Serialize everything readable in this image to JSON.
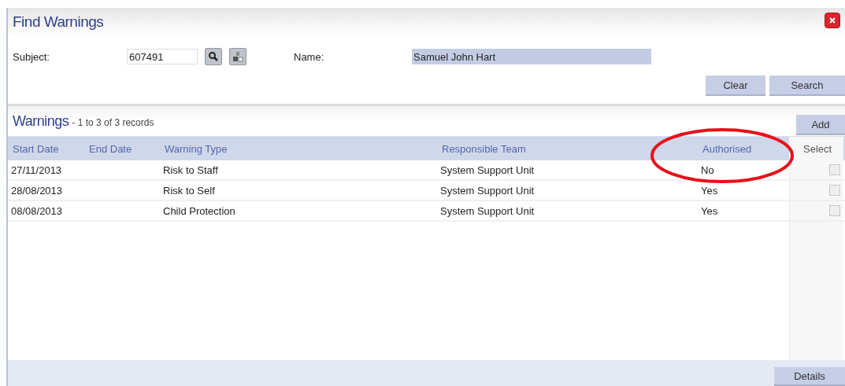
{
  "window": {
    "title": "Find Warnings"
  },
  "search": {
    "subject_label": "Subject:",
    "subject_value": "607491",
    "name_label": "Name:",
    "name_value": "Samuel John Hart",
    "buttons": [
      "Clear",
      "Search"
    ]
  },
  "section": {
    "title": "Warnings",
    "summary": "- 1 to 3 of 3 records",
    "add_button": "Add"
  },
  "table": {
    "columns": [
      "Start Date",
      "End Date",
      "Warning Type",
      "Responsible Team",
      "Authorised",
      "Select"
    ],
    "rows": [
      {
        "cells": [
          "27/11/2013",
          "",
          "Risk to Staff",
          "System Support Unit",
          "No"
        ],
        "checked": false
      },
      {
        "cells": [
          "28/08/2013",
          "",
          "Risk to Self",
          "System Support Unit",
          "Yes"
        ],
        "checked": false
      },
      {
        "cells": [
          "08/08/2013",
          "",
          "Child Protection",
          "System Support Unit",
          "Yes"
        ],
        "checked": false
      }
    ]
  },
  "footer": {
    "button": "Details"
  }
}
